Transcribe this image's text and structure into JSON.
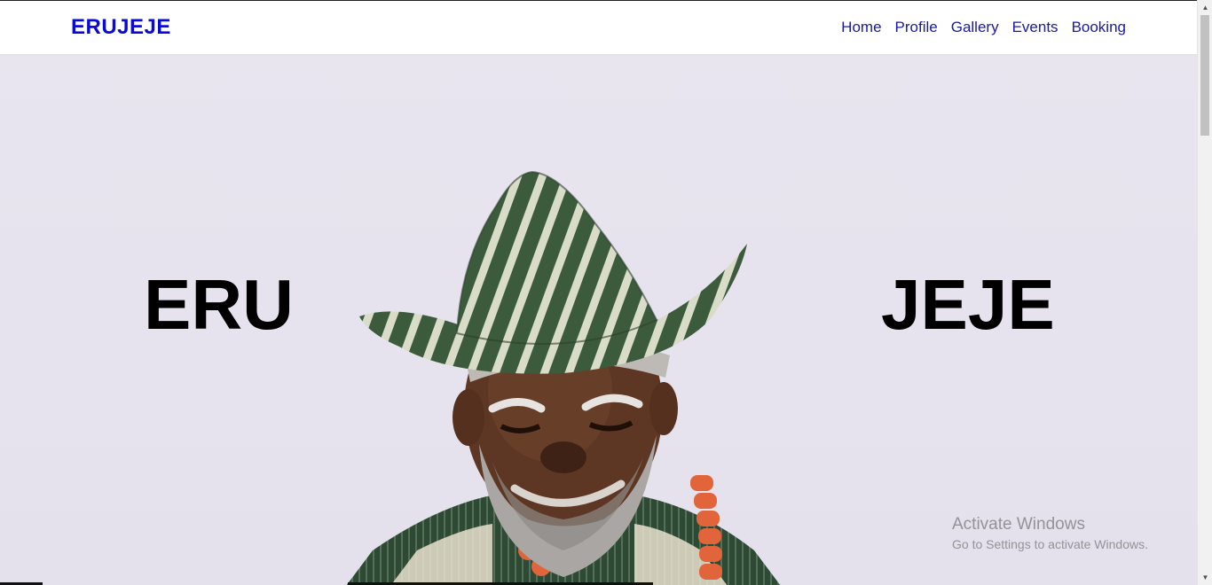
{
  "navbar": {
    "brand": "ERUJEJE",
    "links": [
      {
        "label": "Home"
      },
      {
        "label": "Profile"
      },
      {
        "label": "Gallery"
      },
      {
        "label": "Events"
      },
      {
        "label": "Booking"
      }
    ]
  },
  "hero": {
    "left_word": "ERU",
    "right_word": "JEJE"
  },
  "watermark": {
    "title": "Activate Windows",
    "subtitle": "Go to Settings to activate Windows."
  },
  "colors": {
    "brand": "#0a0ad6",
    "nav_link": "#1a1aa6",
    "hero_bg": "#e6e2ee",
    "hat_green": "#3c5b3c",
    "hat_stripe": "#d9dcc8"
  },
  "icons": {
    "scroll_up": "chevron-up-icon",
    "scroll_down": "chevron-down-icon"
  }
}
